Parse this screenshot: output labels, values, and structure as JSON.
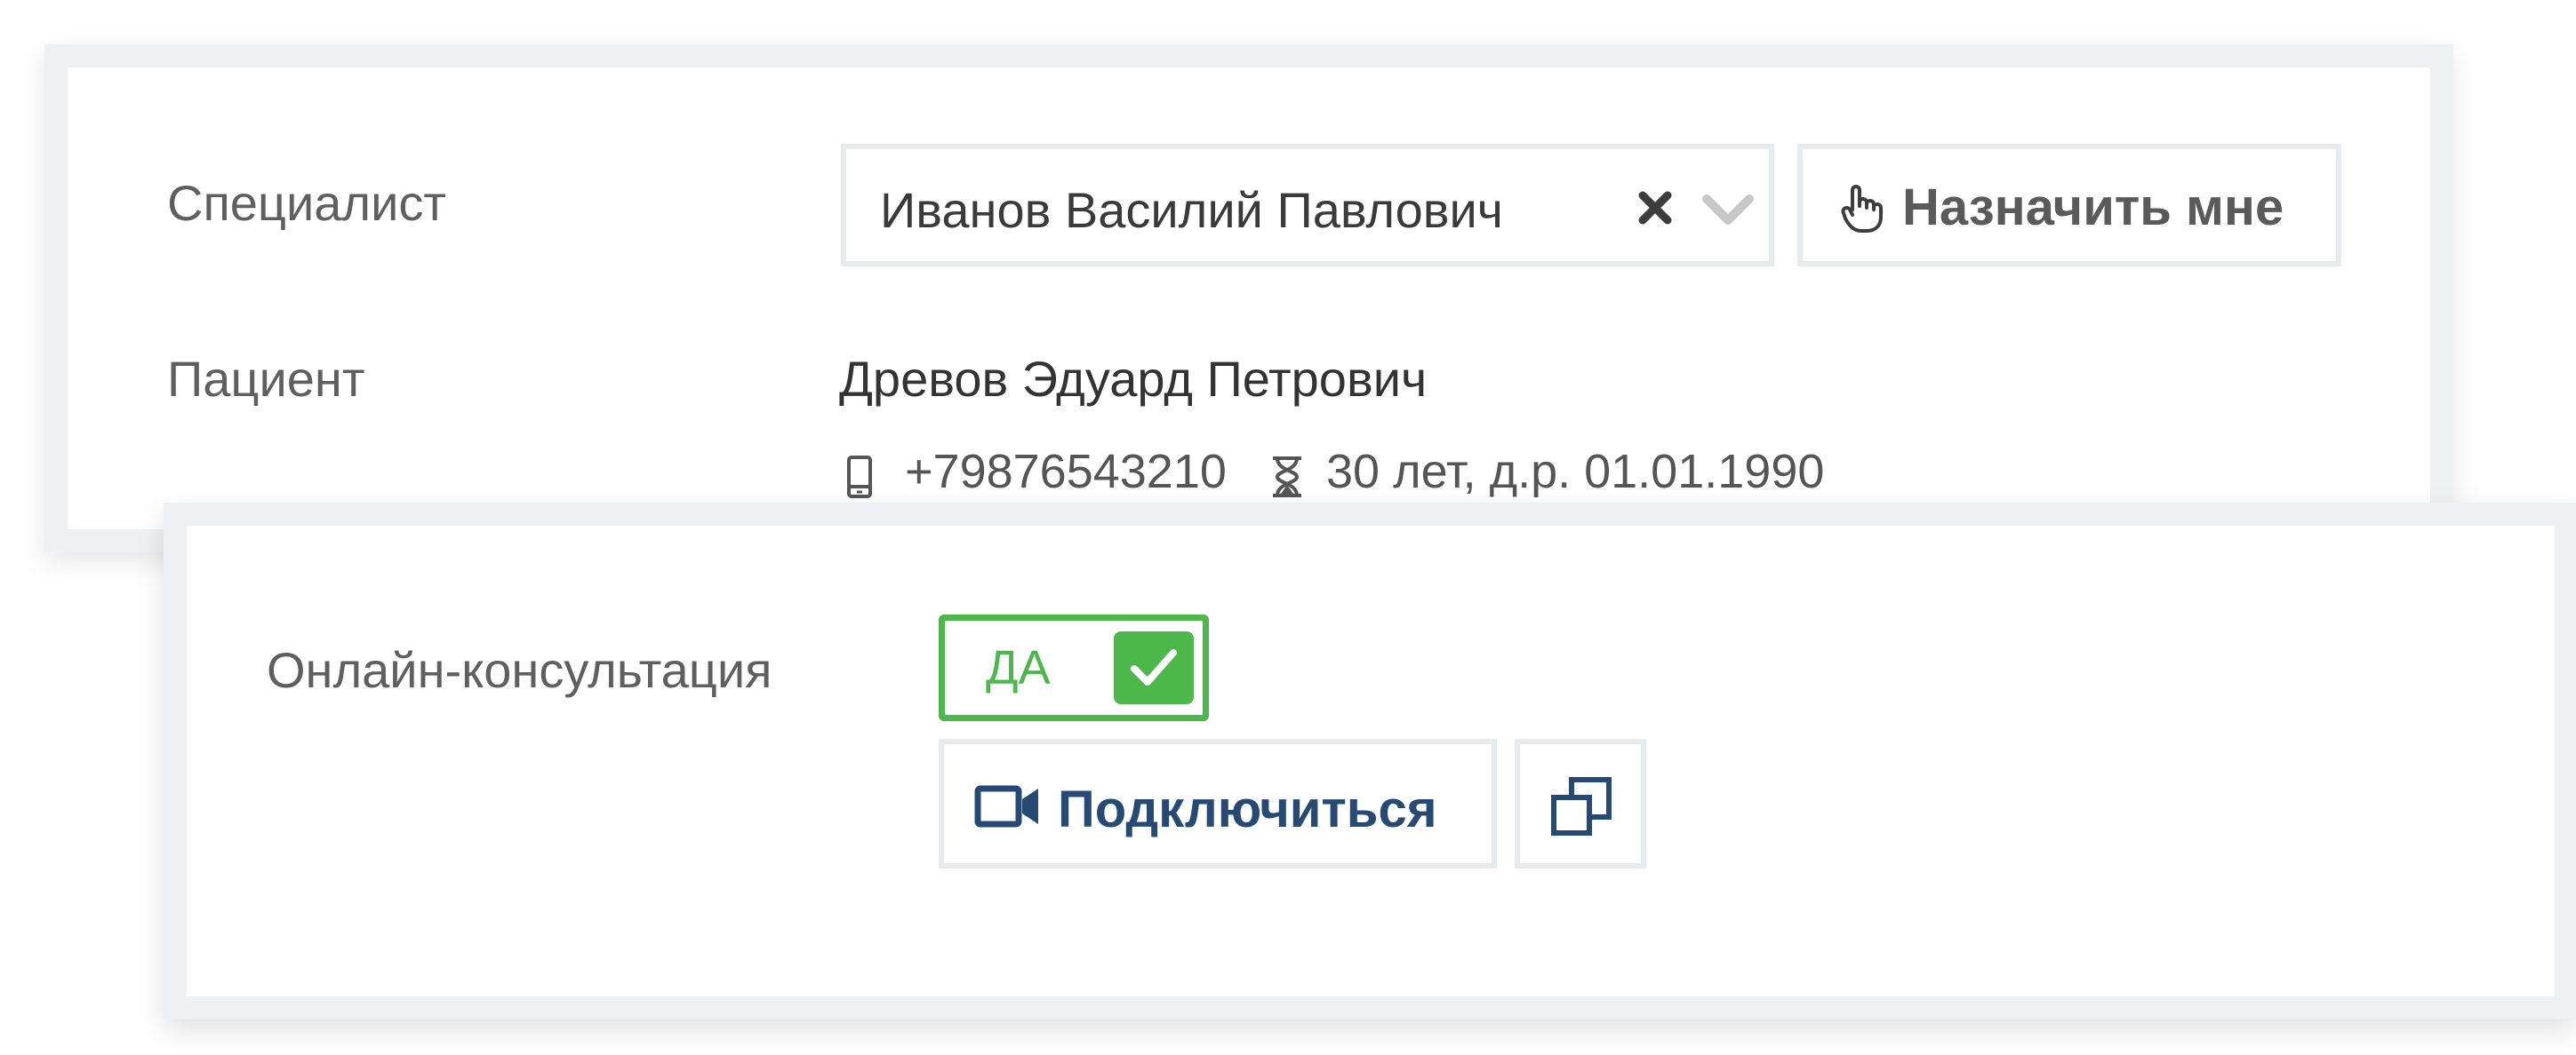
{
  "specialist": {
    "label": "Специалист",
    "selected_value": "Иванов Василий Павлович",
    "clear_icon": "close-icon",
    "dropdown_icon": "chevron-down-icon",
    "assign_button": {
      "label": "Назначить мне",
      "icon": "hand-pointer-icon"
    }
  },
  "patient": {
    "label": "Пациент",
    "name": "Древов Эдуард Петрович",
    "phone": "+79876543210",
    "phone_icon": "mobile-phone-icon",
    "age_info": "30 лет, д.р. 01.01.1990",
    "age_icon": "hourglass-icon"
  },
  "online_consultation": {
    "label": "Онлайн-консультация",
    "toggle_label": "ДА",
    "toggle_checked": true,
    "connect_button": {
      "label": "Подключиться",
      "icon": "video-camera-icon"
    },
    "copy_button_icon": "copy-icon"
  },
  "colors": {
    "toggle_green": "#4cb84c",
    "connect_blue": "#264a73",
    "card_border": "#eef1f4"
  }
}
